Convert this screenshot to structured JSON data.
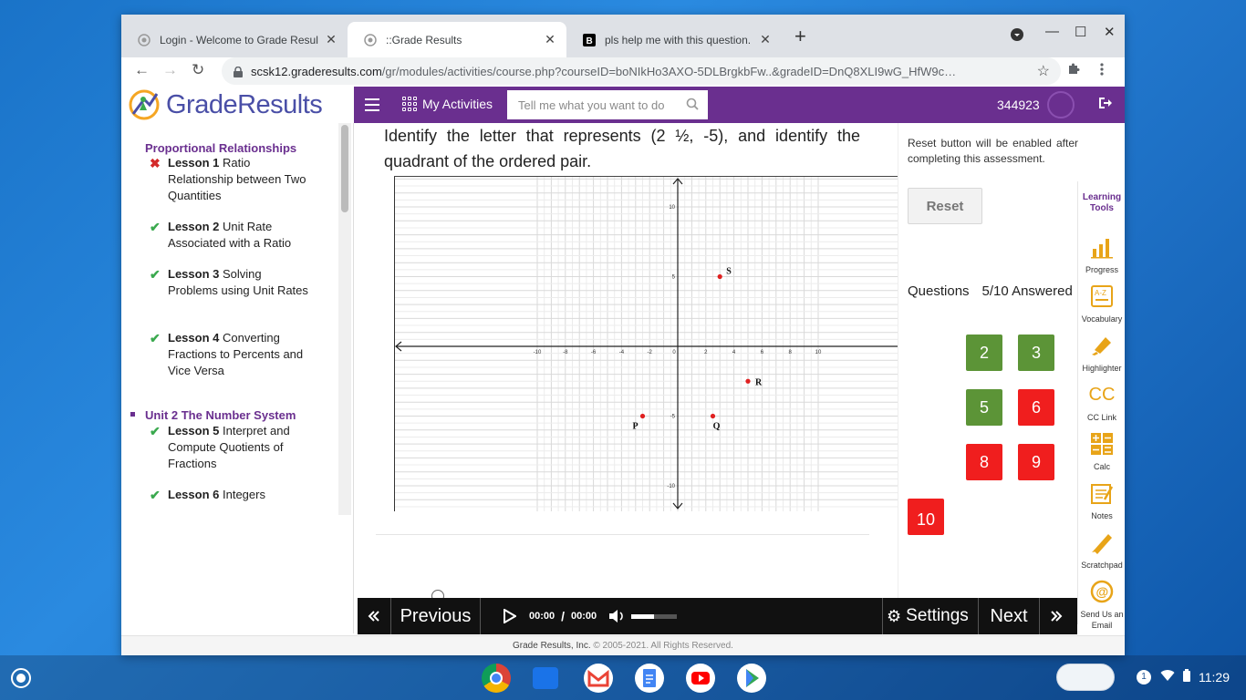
{
  "browser": {
    "tabs": [
      {
        "title": "Login - Welcome to Grade Resul…"
      },
      {
        "title": "::Grade Results"
      },
      {
        "title": "pls help me with this question. -…"
      }
    ],
    "url_host": "scsk12.graderesults.com",
    "url_path": "/gr/modules/activities/course.php?courseID=boNIkHo3AXO-5DLBrgkbFw..&gradeID=DnQ8XLI9wG_HfW9c…"
  },
  "header": {
    "logo_text": "GradeResults",
    "my_activities": "My Activities",
    "search_placeholder": "Tell me what you want to do",
    "user_id": "344923"
  },
  "sidebar": {
    "section_title": "Proportional Relationships",
    "unit2_title": "Unit 2 The Number System",
    "lessons": [
      {
        "num": "Lesson 1",
        "name": "Ratio Relationship between Two Quantities",
        "status": "incorrect"
      },
      {
        "num": "Lesson 2",
        "name": "Unit Rate Associated with a Ratio",
        "status": "complete"
      },
      {
        "num": "Lesson 3",
        "name": "Solving Problems using Unit Rates",
        "status": "complete"
      },
      {
        "num": "Lesson 4",
        "name": "Converting Fractions to Percents and Vice Versa",
        "status": "complete"
      },
      {
        "num": "Lesson 5",
        "name": "Interpret and Compute Quotients of Fractions",
        "status": "complete"
      },
      {
        "num": "Lesson 6",
        "name": "Integers",
        "status": "complete"
      }
    ]
  },
  "question": {
    "text": "Identify the letter that represents (2 ½, -5), and identify the quadrant of the ordered pair."
  },
  "chart_data": {
    "type": "scatter",
    "xlim": [
      -10,
      10
    ],
    "ylim": [
      -12,
      12
    ],
    "grid": true,
    "x_ticks": [
      "-10",
      "-8",
      "-6",
      "-4",
      "-2",
      "0",
      "2",
      "4",
      "6",
      "8",
      "10"
    ],
    "y_ticks": [
      "10",
      "5",
      "-5",
      "-10"
    ],
    "points": [
      {
        "label": "S",
        "x": 3,
        "y": 5
      },
      {
        "label": "R",
        "x": 5,
        "y": -2.5
      },
      {
        "label": "P",
        "x": -2.5,
        "y": -5
      },
      {
        "label": "Q",
        "x": 2.5,
        "y": -5
      }
    ],
    "point_color": "#e02020"
  },
  "right_panel": {
    "reset_note": "Reset button will be enabled after completing this assessment.",
    "reset_label": "Reset",
    "questions_label": "Questions",
    "answered": "5/10 Answered",
    "question_buttons": [
      {
        "n": "2",
        "status": "correct"
      },
      {
        "n": "3",
        "status": "correct"
      },
      {
        "n": "5",
        "status": "correct"
      },
      {
        "n": "6",
        "status": "incorrect"
      },
      {
        "n": "8",
        "status": "incorrect"
      },
      {
        "n": "9",
        "status": "incorrect"
      },
      {
        "n": "10",
        "status": "incorrect"
      }
    ]
  },
  "learning_tools": {
    "title": "Learning Tools",
    "items": [
      {
        "label": "Progress",
        "icon": "progress-icon"
      },
      {
        "label": "Vocabulary",
        "icon": "vocabulary-icon"
      },
      {
        "label": "Highlighter",
        "icon": "highlighter-icon"
      },
      {
        "label": "CC Link",
        "icon": "cc-icon"
      },
      {
        "label": "Calc",
        "icon": "calculator-icon"
      },
      {
        "label": "Notes",
        "icon": "notes-icon"
      },
      {
        "label": "Scratchpad",
        "icon": "scratchpad-icon"
      },
      {
        "label": "Send Us an Email",
        "icon": "email-icon"
      }
    ]
  },
  "player": {
    "previous": "Previous",
    "time_current": "00:00",
    "time_sep": "/",
    "time_total": "00:00",
    "volume": 0.5,
    "settings": "Settings",
    "next": "Next"
  },
  "footer": {
    "company": "Grade Results, Inc.",
    "copyright": "© 2005-2021. All Rights Reserved."
  },
  "taskbar": {
    "notif_count": "1",
    "clock": "11:29",
    "apps": [
      "chrome-icon",
      "files-icon",
      "gmail-icon",
      "docs-icon",
      "youtube-icon",
      "play-store-icon"
    ]
  },
  "colors": {
    "brand_purple": "#6a2f8f",
    "correct_green": "#5c9437",
    "incorrect_red": "#f01e1e"
  }
}
